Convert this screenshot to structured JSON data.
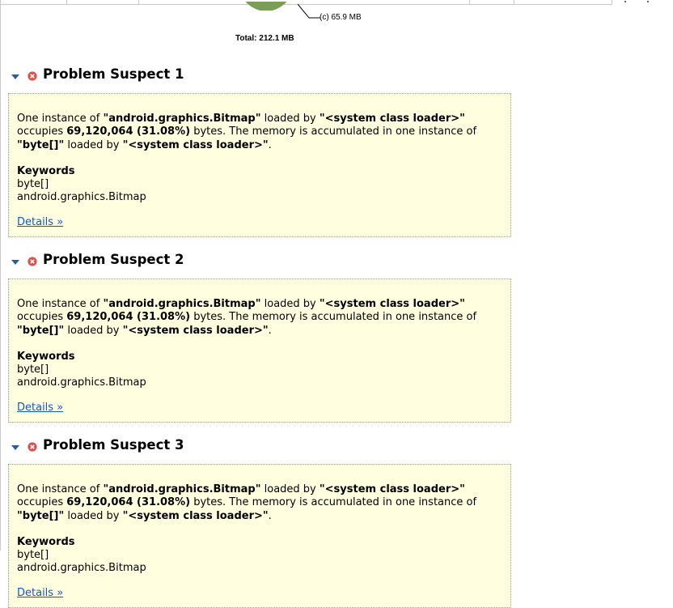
{
  "pie": {
    "slice_label": "(c)  65.9 MB",
    "total": "Total: 212.1 MB"
  },
  "suspects": [
    {
      "title": "Problem Suspect 1",
      "text": {
        "one_instance": "One instance of ",
        "class": "\"android.graphics.Bitmap\"",
        "loaded_by": " loaded by ",
        "loader": "\"<system class loader>\"",
        "occupies": " occupies ",
        "size": "69,120,064 (31.08%)",
        "bytes_sentence": " bytes. The memory is accumulated in one instance of ",
        "acc_class": "\"byte[]\"",
        "loaded_by2": " loaded by ",
        "loader2": "\"<system class loader>\"",
        "period": "."
      },
      "keywords_label": "Keywords",
      "keywords": [
        "byte[]",
        "android.graphics.Bitmap"
      ],
      "details_link": "Details »"
    },
    {
      "title": "Problem Suspect 2",
      "text": {
        "one_instance": "One instance of ",
        "class": "\"android.graphics.Bitmap\"",
        "loaded_by": " loaded by ",
        "loader": "\"<system class loader>\"",
        "occupies": " occupies ",
        "size": "69,120,064 (31.08%)",
        "bytes_sentence": " bytes. The memory is accumulated in one instance of ",
        "acc_class": "\"byte[]\"",
        "loaded_by2": " loaded by ",
        "loader2": "\"<system class loader>\"",
        "period": "."
      },
      "keywords_label": "Keywords",
      "keywords": [
        "byte[]",
        "android.graphics.Bitmap"
      ],
      "details_link": "Details »"
    },
    {
      "title": "Problem Suspect 3",
      "text": {
        "one_instance": "One instance of ",
        "class": "\"android.graphics.Bitmap\"",
        "loaded_by": " loaded by ",
        "loader": "\"<system class loader>\"",
        "occupies": " occupies ",
        "size": "69,120,064 (31.08%)",
        "bytes_sentence": " bytes. The memory is accumulated in one instance of ",
        "acc_class": "\"byte[]\"",
        "loaded_by2": " loaded by ",
        "loader2": "\"<system class loader>\"",
        "period": "."
      },
      "keywords_label": "Keywords",
      "keywords": [
        "byte[]",
        "android.graphics.Bitmap"
      ],
      "details_link": "Details »"
    }
  ],
  "colors": {
    "box_background": "#ffffe0",
    "link": "#1155cc",
    "error_icon": "#d9534f",
    "pie_green": "#7a9e5a"
  },
  "icons": [
    "collapse-triangle-icon",
    "error-icon"
  ]
}
